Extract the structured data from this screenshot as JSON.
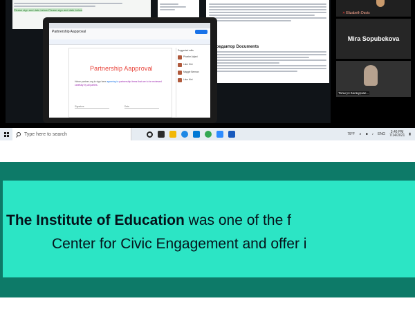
{
  "doc_left": {
    "highlight_text": "Please sign and date below Please sign and date below"
  },
  "doc_ru": {
    "heading": "ый редактор Documents"
  },
  "laptop_doc": {
    "title": "Partnership Aapproval",
    "page_title": "Partnership Aapproval",
    "body_intro": "Heine-partner-org to sign here",
    "body_inserted": "agreeing to",
    "body_rest": "partnership items that are to be reviewed carefully by all parties.",
    "signature_label": "Signature",
    "date_label": "Date",
    "suggest_header": "Suggested edits",
    "suggestion_items": [
      "Phoebe Adjani",
      "Luke Hint",
      "Maggie Berman",
      "Luke Hint"
    ]
  },
  "participants": {
    "elizabeth": "Elizabeth Davis",
    "mira": "Mira Sopubekova",
    "tatygul": "Татыгул Калмурзае..."
  },
  "taskbar": {
    "search_placeholder": "Type here to search",
    "weather": "78°F",
    "language": "ENG",
    "time": "3:46 PM",
    "date": "7/14/2021"
  },
  "caption": {
    "line1_bold": "The Institute of Education",
    "line1_rest": " was one of the f",
    "line2": "Center for Civic Engagement and offer i"
  },
  "colors": {
    "band_dark": "#0d7a68",
    "band_light": "#2ce5c5",
    "doc_title_red": "#e8433a"
  }
}
